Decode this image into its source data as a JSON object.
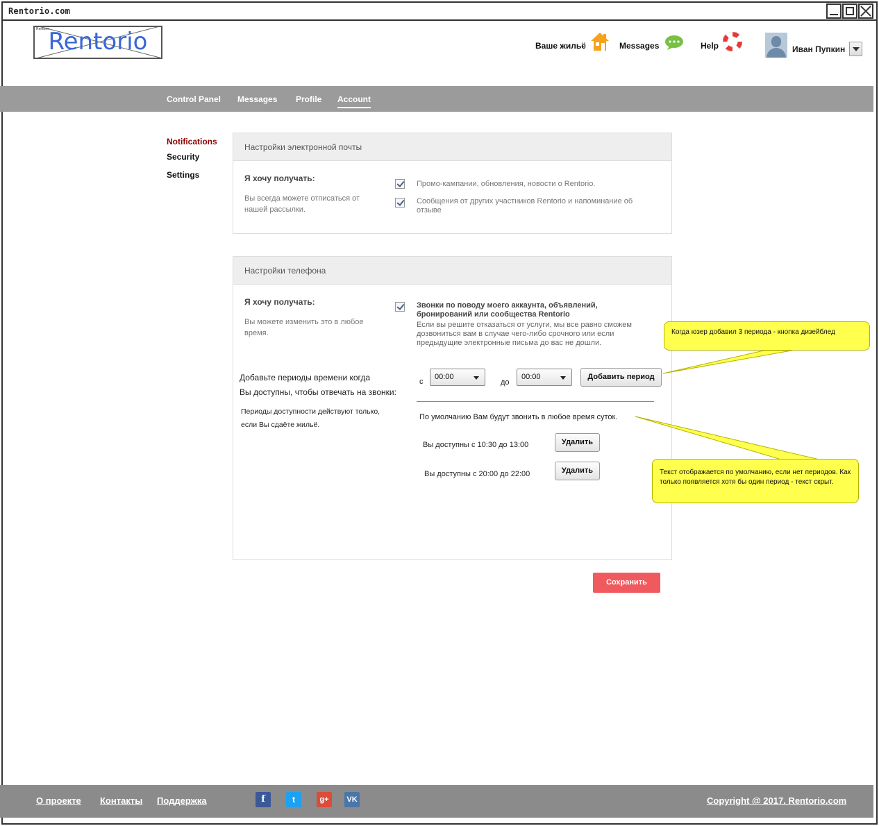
{
  "window": {
    "title": "Rentorio.com"
  },
  "logo": {
    "text": "Rentorio",
    "small": "Rentorio"
  },
  "header": {
    "housing_label": "Ваше жильё",
    "messages_label": "Messages",
    "help_label": "Help",
    "user_name": "Иван Пупкин"
  },
  "nav": {
    "items": [
      "Control Panel",
      "Messages",
      "Profile",
      "Account"
    ],
    "active": "Account"
  },
  "sidebar": {
    "items": [
      "Notifications",
      "Security",
      "Settings"
    ],
    "active": "Notifications"
  },
  "email_panel": {
    "title": "Настройки электронной почты",
    "want_label": "Я хочу получать:",
    "hint": "Вы всегда можете отписаться от нашей рассылки.",
    "options": [
      {
        "label": "Промо-кампании, обновления, новости о Rentorio.",
        "checked": true
      },
      {
        "label": "Сообщения от других участников Rentorio и напоминание об отзыве",
        "checked": true
      }
    ]
  },
  "phone_panel": {
    "title": "Настройки телефона",
    "want_label": "Я хочу получать:",
    "hint": "Вы можете изменить это в любое время.",
    "calls_title": "Звонки по поводу моего аккаунта, объявлений, бронирований или сообщества Rentorio",
    "calls_desc": "Если вы решите отказаться от услуги, мы все равно сможем дозвониться вам в случае чего-либо срочного или если предыдущие электронные письма до вас не дошли.",
    "calls_checked": true,
    "periods_label_line1": "Добавьте периоды времени когда",
    "periods_label_line2": "Вы доступны, чтобы отвечать на звонки:",
    "periods_note": "Периоды доступности действуют только, если Вы сдаёте жильё.",
    "from_label": "с",
    "to_label": "до",
    "from_value": "00:00",
    "to_value": "00:00",
    "add_button": "Добавить период",
    "default_text": "По умолчанию Вам будут звонить в любое время суток.",
    "periods": [
      {
        "text": "Вы доступны  с 10:30 до 13:00",
        "delete_label": "Удалить"
      },
      {
        "text": "Вы доступны  с 20:00 до 22:00",
        "delete_label": "Удалить"
      }
    ]
  },
  "save_button": "Сохранить",
  "notes": {
    "note1": "Когда юзер добавил 3 периода - кнопка дизейблед",
    "note2": "Текст отображается по умолчанию, если нет периодов.  Как только появляется хотя бы один период - текст скрыт."
  },
  "footer": {
    "links": [
      "О проекте",
      "Контакты",
      "Поддержка"
    ],
    "social": [
      "facebook-icon",
      "twitter-icon",
      "google-plus-icon",
      "vk-icon"
    ],
    "social_labels": {
      "facebook": "f",
      "twitter": "t",
      "google": "g+",
      "vk": "VK"
    },
    "copyright": "Copyright @ 2017. Rentorio.com"
  },
  "colors": {
    "nav_bg": "#9b9b9b",
    "footer_bg": "#8b8b8b",
    "save": "#f05a5f",
    "active_side": "#8b0000",
    "logo": "#3867d6",
    "note": "#ffff4d"
  }
}
